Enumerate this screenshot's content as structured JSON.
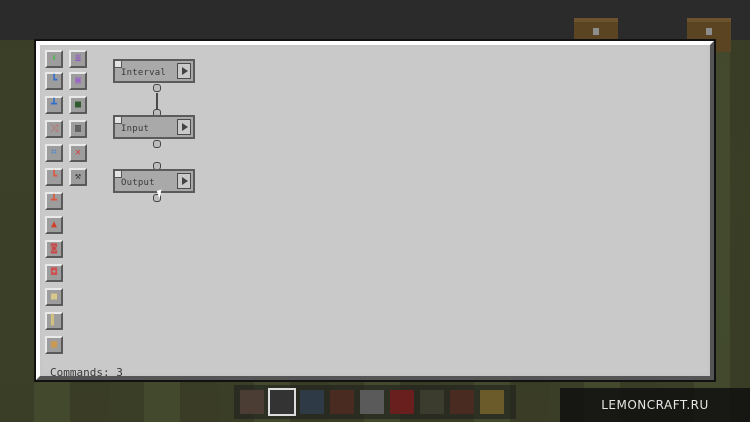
{
  "toolbar": {
    "tools": [
      {
        "icon": "green-down-arrow-icon",
        "color": "#55c35a"
      },
      {
        "icon": "purple-list-icon",
        "color": "#a06ad8"
      },
      {
        "icon": "input-connector-icon",
        "color": "#4a8bd8"
      },
      {
        "icon": "purple-chip-icon",
        "color": "#9a63c8"
      },
      {
        "icon": "output-connector-icon",
        "color": "#4a8bd8"
      },
      {
        "icon": "green-square-icon",
        "color": "#2f5a2f"
      },
      {
        "icon": "split-arrow-icon",
        "color": "#d05a5a"
      },
      {
        "icon": "variable-bars-icon",
        "color": "#3a3a3a"
      },
      {
        "icon": "network-icon",
        "color": "#3a86d8"
      },
      {
        "icon": "red-x-icon",
        "color": "#d04040"
      },
      {
        "icon": "input-fire-icon",
        "color": "#e0553b"
      },
      {
        "icon": "wrench-icon",
        "color": "#4a4a4a"
      },
      {
        "icon": "output-fire-icon",
        "color": "#e0553b"
      },
      {
        "icon": "flame-red-icon",
        "color": "#d0402a"
      },
      {
        "icon": "redstone-emitter-icon",
        "color": "#c84a4a"
      },
      {
        "icon": "redstone-receiver-icon",
        "color": "#d05050"
      },
      {
        "icon": "sign-blank-icon",
        "color": "#d8c88a"
      },
      {
        "icon": "sign-side-icon",
        "color": "#d2c080"
      },
      {
        "icon": "crafting-grid-icon",
        "color": "#d89a3a"
      }
    ]
  },
  "nodes": [
    {
      "label": "Interval"
    },
    {
      "label": "Input"
    },
    {
      "label": "Output"
    }
  ],
  "status": {
    "commands_text": "Commands: 3"
  },
  "watermark": {
    "text": "LEMONCRAFT.RU"
  }
}
